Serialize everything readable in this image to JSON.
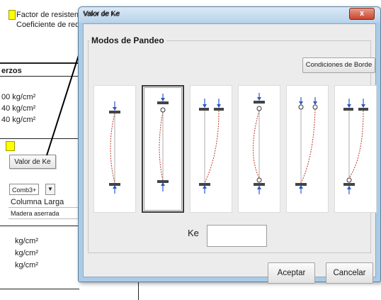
{
  "spreadsheet": {
    "row1_label": "Factor de resistenci",
    "row2_label": "Coeficiente de reduc",
    "section_label": "erzos",
    "stress_values": [
      "00 kg/cm²",
      "40 kg/cm²",
      "40 kg/cm²"
    ],
    "button_label": "Valor de Ke",
    "combo_value": "Comb3+",
    "combo_arrow": "▼",
    "column_type": "Columna Larga",
    "material": "Madera aserrada",
    "lower_units": [
      "kg/cm²",
      "kg/cm²",
      "kg/cm²"
    ],
    "highlight_color": "#ffff00"
  },
  "callout": {
    "label": "Valor de Ke"
  },
  "dialog": {
    "title": "Valor de Ke",
    "close_label": "x",
    "frame_label": "Modos de Pandeo",
    "boundary_button": "Condiciones de Borde",
    "modes": [
      {
        "name": "mode-1",
        "selected": false
      },
      {
        "name": "mode-2",
        "selected": true
      },
      {
        "name": "mode-3",
        "selected": false
      },
      {
        "name": "mode-4",
        "selected": false
      },
      {
        "name": "mode-5",
        "selected": false
      },
      {
        "name": "mode-6",
        "selected": false
      }
    ],
    "ke_label": "Ke",
    "ke_value": "",
    "accept_label": "Aceptar",
    "cancel_label": "Cancelar",
    "curve_color": "#c0392b",
    "arrow_color": "#2b59c3"
  }
}
